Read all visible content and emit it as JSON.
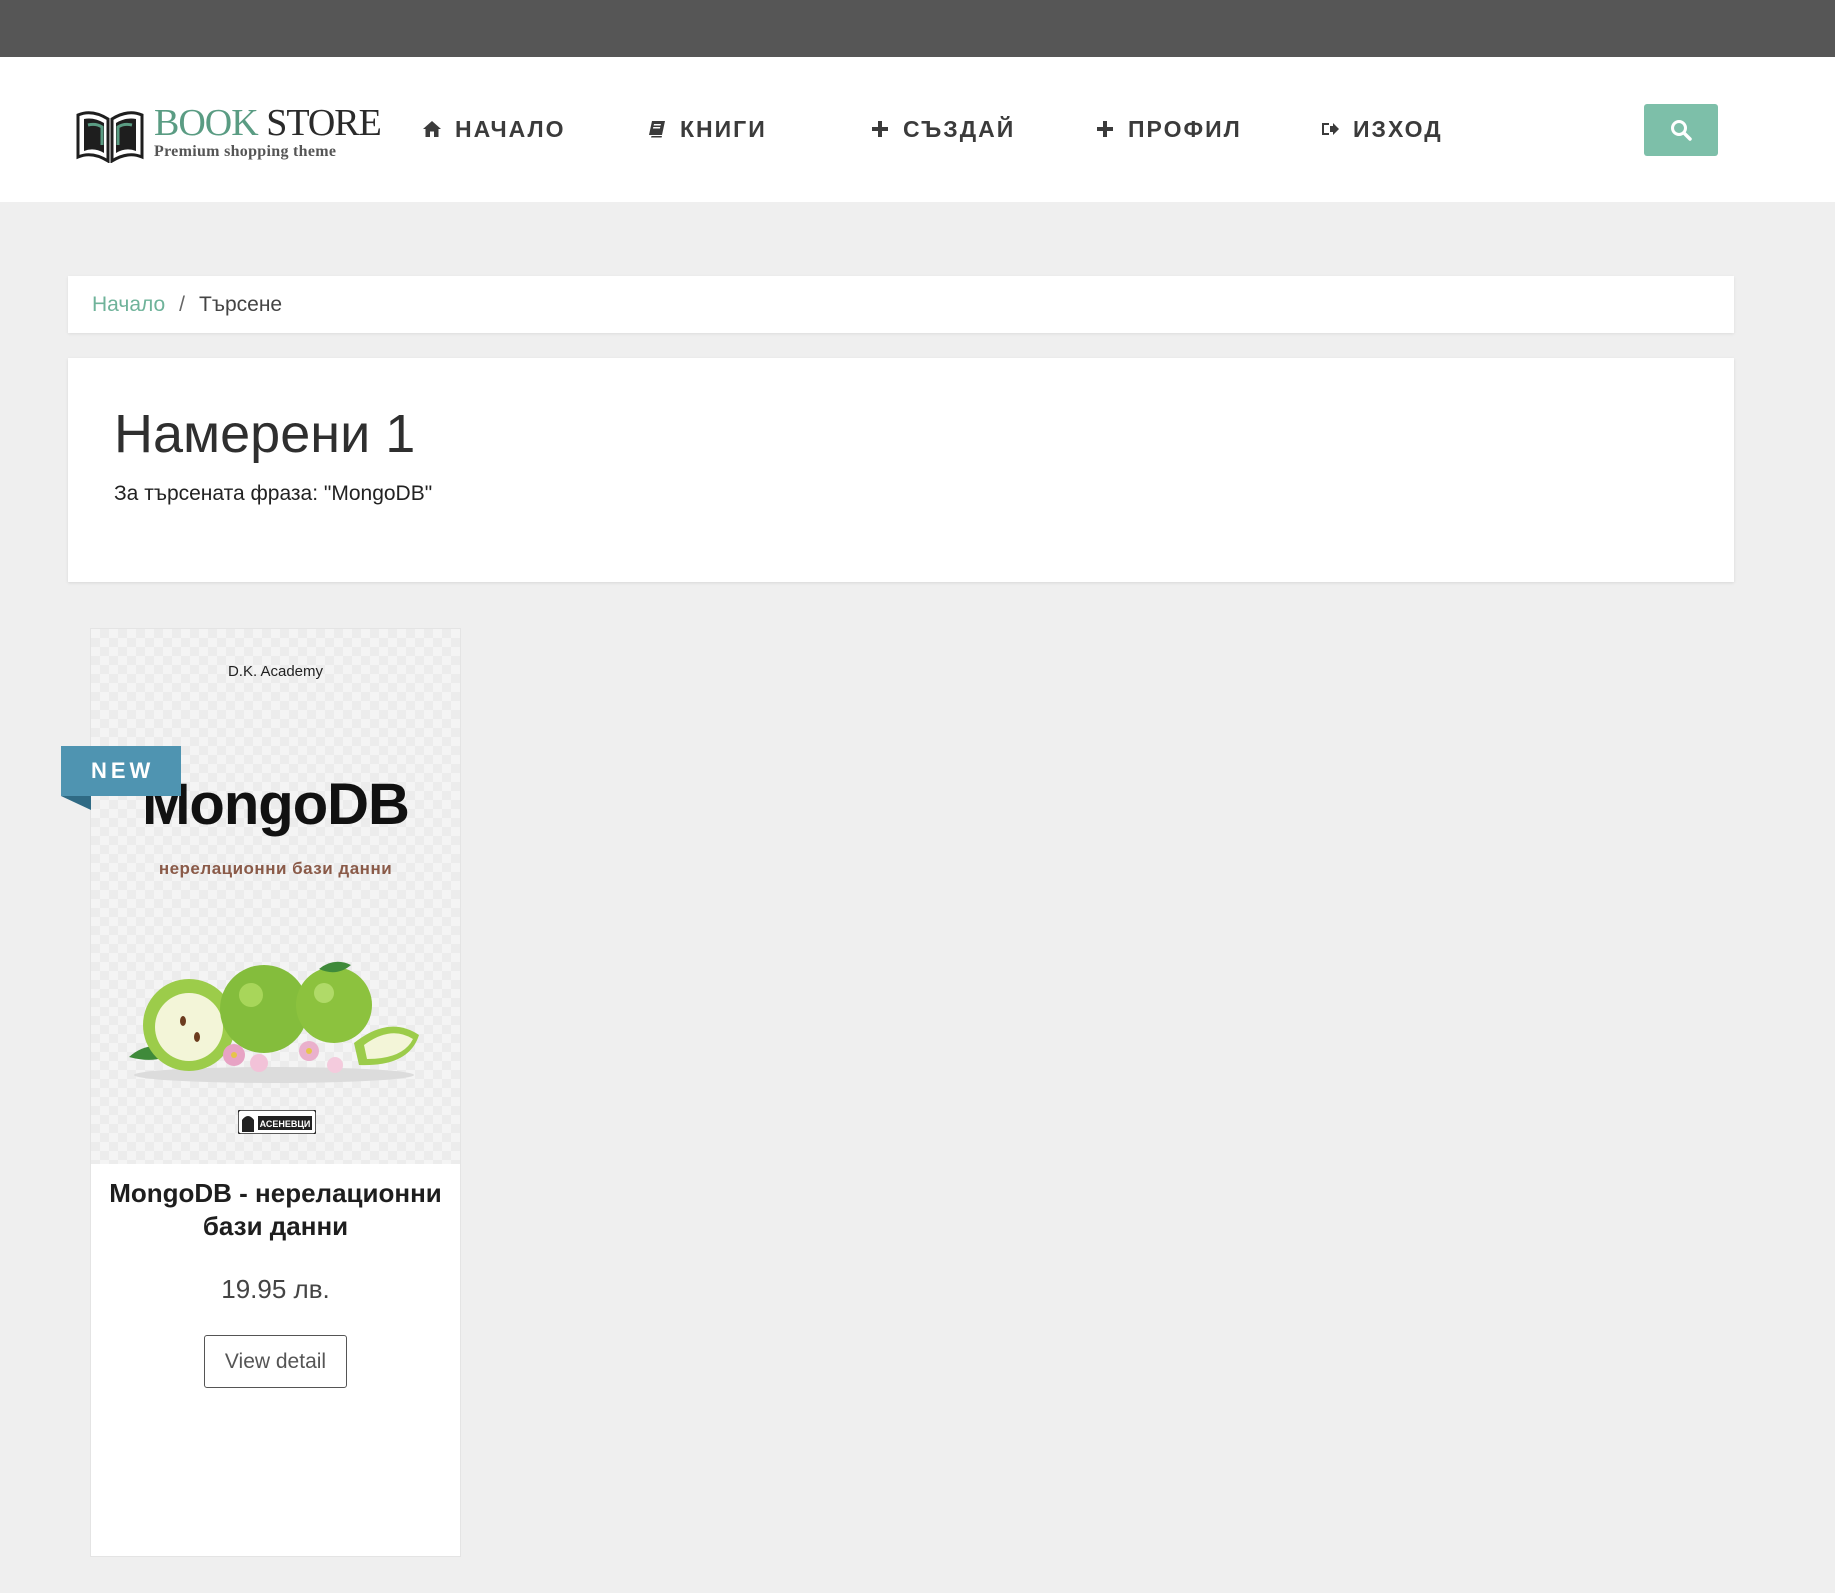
{
  "logo": {
    "title_part1": "BOOK",
    "title_part2": "STORE",
    "subtitle": "Premium shopping theme",
    "icon": "open-book-icon"
  },
  "nav": {
    "items": [
      {
        "label": "НАЧАЛО",
        "icon": "home-icon"
      },
      {
        "label": "КНИГИ",
        "icon": "book-icon"
      },
      {
        "label": "СЪЗДАЙ",
        "icon": "plus-icon"
      },
      {
        "label": "ПРОФИЛ",
        "icon": "plus-icon"
      },
      {
        "label": "ИЗХОД",
        "icon": "sign-out-icon"
      }
    ],
    "search_icon": "search-icon"
  },
  "breadcrumb": {
    "home": "Начало",
    "separator": "/",
    "current": "Търсене"
  },
  "results": {
    "title": "Намерени 1",
    "query_text": "За търсената фраза: \"MongoDB\""
  },
  "products": [
    {
      "badge": "NEW",
      "cover": {
        "publisher": "D.K. Academy",
        "title": "MongoDB",
        "subtitle": "нерелационни бази данни",
        "imprint": "АСЕНЕВЦИ"
      },
      "title": "MongoDB - нерелационни бази данни",
      "price": "19.95 лв.",
      "button": "View detail"
    }
  ],
  "colors": {
    "accent": "#7dbfa9",
    "link": "#6fb39a",
    "badge": "#4f94b1",
    "topbar": "#565656",
    "page_bg": "#efefef"
  }
}
